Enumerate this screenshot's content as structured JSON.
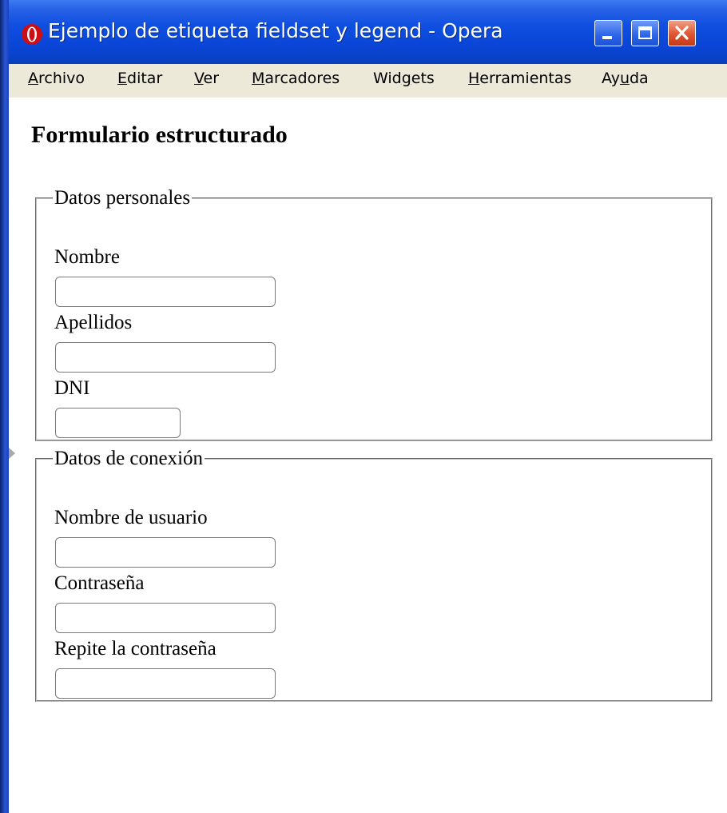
{
  "window": {
    "title": "Ejemplo de etiqueta fieldset y legend - Opera",
    "controls": {
      "minimize_icon": "minimize-icon",
      "maximize_icon": "maximize-icon",
      "close_icon": "close-icon"
    },
    "colors": {
      "titlebar": "#0a46d8",
      "menubar": "#ece9d8",
      "close": "#e0552e"
    }
  },
  "menubar": {
    "items": [
      {
        "label": "Archivo",
        "mnemonic": "A",
        "rest": "rchivo"
      },
      {
        "label": "Editar",
        "mnemonic": "E",
        "rest": "ditar"
      },
      {
        "label": "Ver",
        "mnemonic": "V",
        "rest": "er"
      },
      {
        "label": "Marcadores",
        "mnemonic": "M",
        "rest": "arcadores"
      },
      {
        "label": "Widgets",
        "pre": "Wid",
        "mnemonic": "g",
        "rest": "ets"
      },
      {
        "label": "Herramientas",
        "mnemonic": "H",
        "rest": "erramientas"
      },
      {
        "label": "Ayuda",
        "pre": "Ay",
        "mnemonic": "u",
        "rest": "da"
      }
    ]
  },
  "page": {
    "title": "Formulario estructurado",
    "fieldsets": [
      {
        "legend": "Datos personales",
        "fields": [
          {
            "label": "Nombre",
            "value": ""
          },
          {
            "label": "Apellidos",
            "value": ""
          },
          {
            "label": "DNI",
            "value": ""
          }
        ]
      },
      {
        "legend": "Datos de conexión",
        "fields": [
          {
            "label": "Nombre de usuario",
            "value": ""
          },
          {
            "label": "Contraseña",
            "value": ""
          },
          {
            "label": "Repite la contraseña",
            "value": ""
          }
        ]
      }
    ]
  }
}
